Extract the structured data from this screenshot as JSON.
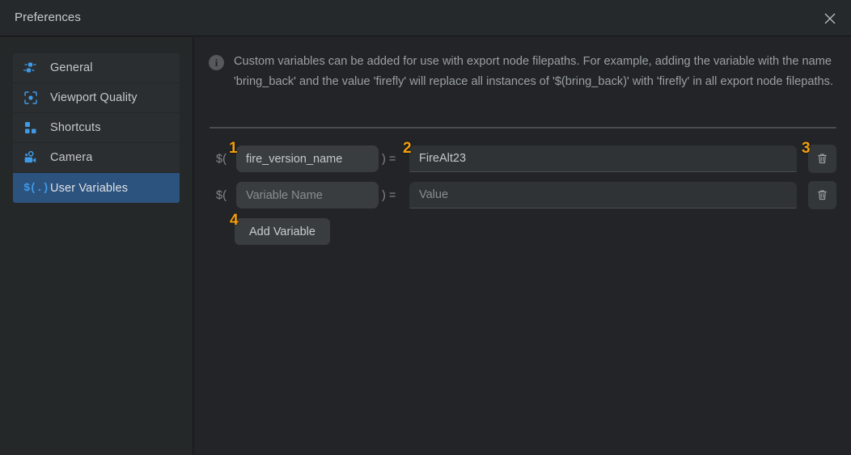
{
  "window": {
    "title": "Preferences",
    "close_icon": "close-icon"
  },
  "sidebar": {
    "items": [
      {
        "label": "General",
        "icon": "nodes-icon",
        "selected": false
      },
      {
        "label": "Viewport Quality",
        "icon": "focus-box-icon",
        "selected": false
      },
      {
        "label": "Shortcuts",
        "icon": "squares-icon",
        "selected": false
      },
      {
        "label": "Camera",
        "icon": "camera-icon",
        "selected": false
      },
      {
        "label": "User Variables",
        "icon": "variable-icon",
        "selected": true
      }
    ]
  },
  "main": {
    "info": {
      "icon": "info-icon",
      "text": "Custom variables can be added for use with export node filepaths. For example, adding the variable with the name 'bring_back' and the value 'firefly' will replace all instances of '$(bring_back)' with 'firefly' in all export node filepaths."
    },
    "row_prefix": "$(",
    "row_suffix": ") =",
    "variables": [
      {
        "name_value": "fire_version_name",
        "name_placeholder": "Variable Name",
        "value_value": "FireAlt23",
        "value_placeholder": "Value",
        "delete_icon": "trash-icon"
      },
      {
        "name_value": "",
        "name_placeholder": "Variable Name",
        "value_value": "",
        "value_placeholder": "Value",
        "delete_icon": "trash-icon"
      }
    ],
    "add_button_label": "Add Variable"
  },
  "annotations": {
    "marker_1": "1",
    "marker_2": "2",
    "marker_3": "3",
    "marker_4": "4",
    "color": "#f59f0b"
  },
  "colors": {
    "accent_blue": "#3f9ae8",
    "selected_row": "#2c527e",
    "panel_bg": "#222427",
    "sidebar_bg": "#252829",
    "titlebar_bg": "#26292b"
  }
}
